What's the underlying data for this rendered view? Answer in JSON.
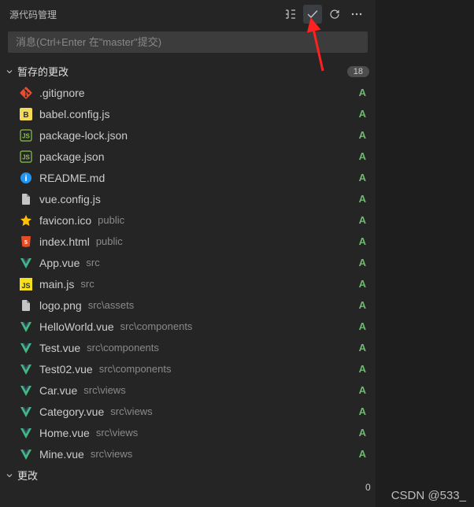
{
  "header": {
    "title": "源代码管理"
  },
  "input": {
    "placeholder": "消息(Ctrl+Enter 在\"master\"提交)"
  },
  "staged": {
    "title": "暂存的更改",
    "count": "18",
    "files": [
      {
        "icon": "git",
        "name": ".gitignore",
        "path": "",
        "status": "A"
      },
      {
        "icon": "babel",
        "name": "babel.config.js",
        "path": "",
        "status": "A"
      },
      {
        "icon": "js-green",
        "name": "package-lock.json",
        "path": "",
        "status": "A"
      },
      {
        "icon": "js-green",
        "name": "package.json",
        "path": "",
        "status": "A"
      },
      {
        "icon": "info",
        "name": "README.md",
        "path": "",
        "status": "A"
      },
      {
        "icon": "file",
        "name": "vue.config.js",
        "path": "",
        "status": "A"
      },
      {
        "icon": "star",
        "name": "favicon.ico",
        "path": "public",
        "status": "A"
      },
      {
        "icon": "html",
        "name": "index.html",
        "path": "public",
        "status": "A"
      },
      {
        "icon": "vue",
        "name": "App.vue",
        "path": "src",
        "status": "A"
      },
      {
        "icon": "js",
        "name": "main.js",
        "path": "src",
        "status": "A"
      },
      {
        "icon": "file",
        "name": "logo.png",
        "path": "src\\assets",
        "status": "A"
      },
      {
        "icon": "vue",
        "name": "HelloWorld.vue",
        "path": "src\\components",
        "status": "A"
      },
      {
        "icon": "vue",
        "name": "Test.vue",
        "path": "src\\components",
        "status": "A"
      },
      {
        "icon": "vue",
        "name": "Test02.vue",
        "path": "src\\components",
        "status": "A"
      },
      {
        "icon": "vue",
        "name": "Car.vue",
        "path": "src\\views",
        "status": "A"
      },
      {
        "icon": "vue",
        "name": "Category.vue",
        "path": "src\\views",
        "status": "A"
      },
      {
        "icon": "vue",
        "name": "Home.vue",
        "path": "src\\views",
        "status": "A"
      },
      {
        "icon": "vue",
        "name": "Mine.vue",
        "path": "src\\views",
        "status": "A"
      }
    ]
  },
  "changes": {
    "title": "更改",
    "count": "0"
  },
  "watermark": "CSDN @533_"
}
